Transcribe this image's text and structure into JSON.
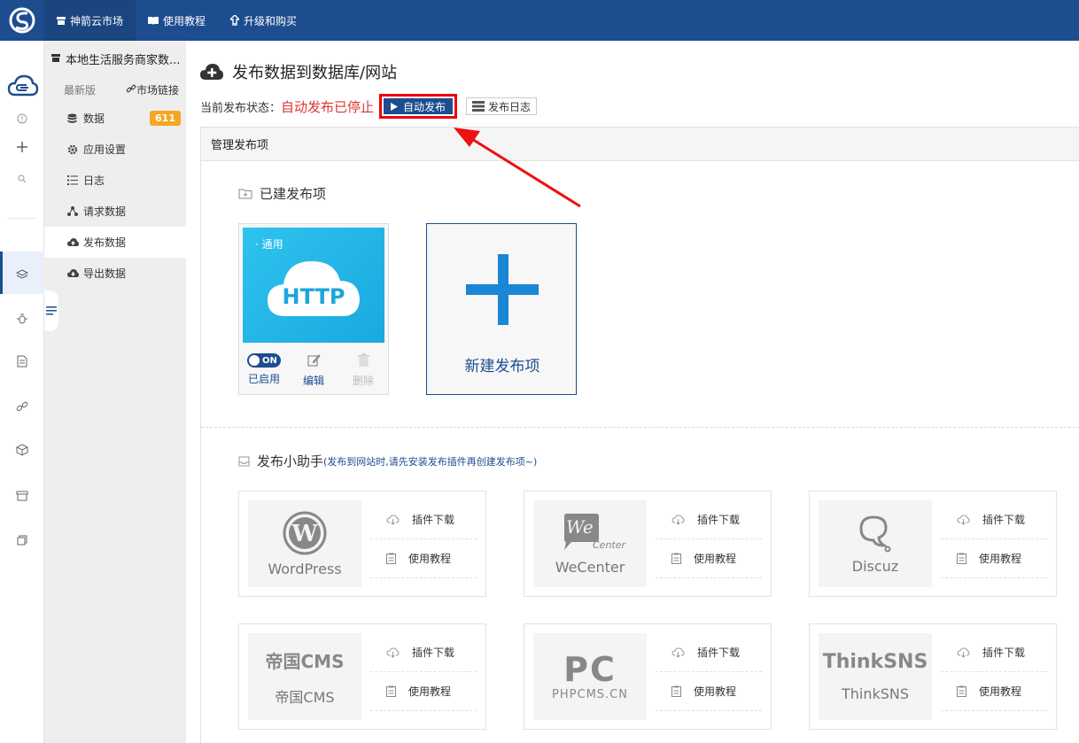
{
  "topnav": [
    {
      "label": "神箭云市场",
      "icon": "store-icon"
    },
    {
      "label": "使用教程",
      "icon": "book-icon"
    },
    {
      "label": "升级和购买",
      "icon": "upgrade-icon"
    }
  ],
  "subnav": {
    "title": "本地生活服务商家数...",
    "version": "最新版",
    "market_link": "市场链接",
    "items": [
      {
        "label": "数据",
        "badge": "611"
      },
      {
        "label": "应用设置"
      },
      {
        "label": "日志"
      },
      {
        "label": "请求数据"
      },
      {
        "label": "发布数据"
      },
      {
        "label": "导出数据"
      }
    ]
  },
  "main": {
    "title": "发布数据到数据库/网站",
    "status_label": "当前发布状态：",
    "status_value": "自动发布已停止",
    "auto_publish_button": "自动发布",
    "publish_log_button": "发布日志",
    "panel_title": "管理发布项",
    "created_section": "已建发布项",
    "http_card": {
      "tag": "· 通用",
      "logo_text": "HTTP",
      "toggle": "ON",
      "enabled_label": "已启用",
      "edit_label": "编辑",
      "delete_label": "删除"
    },
    "new_card_label": "新建发布项",
    "helper_title": "发布小助手",
    "helper_note": "(发布到网站时,请先安装发布插件再创建发布项~)",
    "plugins": [
      {
        "name": "WordPress",
        "download": "插件下载",
        "tutorial": "使用教程"
      },
      {
        "name": "WeCenter",
        "logo_text": "We",
        "logo_sub": "Center",
        "download": "插件下载",
        "tutorial": "使用教程"
      },
      {
        "name": "Discuz",
        "download": "插件下载",
        "tutorial": "使用教程"
      },
      {
        "name": "帝国CMS",
        "logo_text": "帝国CMS",
        "download": "插件下载",
        "tutorial": "使用教程"
      },
      {
        "name": "PHPCMS.CN",
        "logo_text": "PC",
        "download": "插件下载",
        "tutorial": "使用教程"
      },
      {
        "name": "ThinkSNS",
        "logo_text": "ThinkSNS",
        "download": "插件下载",
        "tutorial": "使用教程"
      }
    ]
  },
  "colors": {
    "topbar": "#1d4c8f",
    "accent": "#1d4c8f",
    "badge": "#f5a623",
    "status_stopped": "#dd3333",
    "highlight": "#ee0000"
  }
}
